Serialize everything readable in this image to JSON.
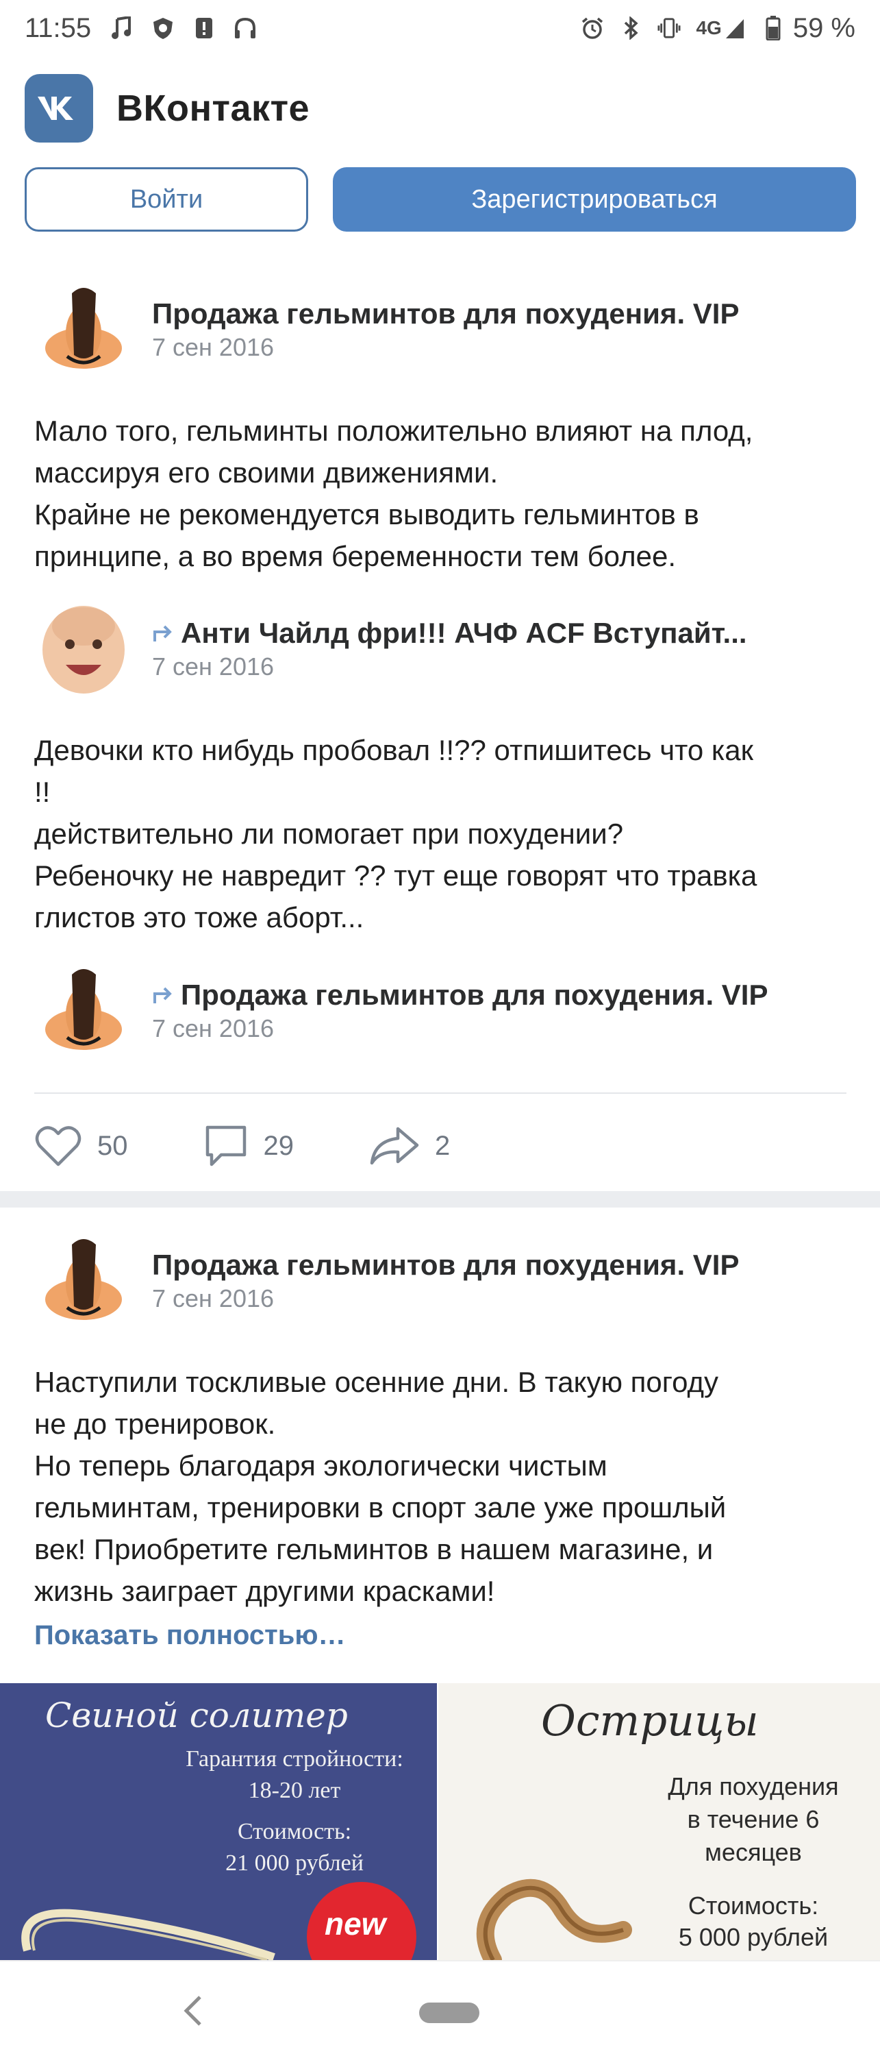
{
  "status_bar": {
    "time": "11:55",
    "network": "4G",
    "battery_percent": "59 %",
    "icons_left": [
      "music-note-icon",
      "shield-app-icon",
      "alert-icon",
      "headphones-icon"
    ],
    "icons_right": [
      "alarm-icon",
      "bluetooth-icon",
      "vibrate-icon",
      "signal-icon",
      "battery-icon"
    ]
  },
  "header": {
    "title": "ВКонтакте",
    "logo_text": "VK"
  },
  "auth": {
    "login_label": "Войти",
    "register_label": "Зарегистрироваться"
  },
  "posts": [
    {
      "author": "Продажа гельминтов для похудения. VIP",
      "date": "7 сен 2016",
      "text": "Мало того, гельминты положительно влияют на плод,\nмассируя его своими движениями.\nКрайне не рекомендуется выводить гельминтов в\nпринципе, а во время беременности тем более.",
      "reposts_chain": [
        {
          "author": "Анти Чайлд фри!!! АЧФ ACF Вступайт...",
          "date": "7 сен 2016",
          "text": "Девочки кто нибудь пробовал !!?? отпишитесь что как\n!!\nдействительно ли помогает при похудении?\nРебеночку не навредит ?? тут еще говорят что травка\nглистов это тоже аборт..."
        },
        {
          "author": "Продажа гельминтов для похудения. VIP",
          "date": "7 сен 2016"
        }
      ],
      "likes": "50",
      "comments": "29",
      "shares": "2"
    },
    {
      "author": "Продажа гельминтов для похудения. VIP",
      "date": "7 сен 2016",
      "text": "Наступили тоскливые осенние дни. В такую погоду\nне до тренировок.\nНо теперь благодаря экологически чистым\nгельминтам, тренировки в спорт зале уже прошлый\nвек! Приобретите гельминтов в нашем магазине, и\nжизнь заиграет другими красками!",
      "show_more": "Показать полностью…",
      "images": [
        {
          "title": "Свиной солитер",
          "line1": "Гарантия стройности:",
          "line2": "18-20 лет",
          "line3": "Стоимость:",
          "line4": "21 000 рублей",
          "badge": "new"
        },
        {
          "title": "Острицы",
          "line1": "Для похудения",
          "line2": "в течение 6",
          "line3": "месяцев",
          "line4": "Стоимость:",
          "line5": "5 000 рублей"
        }
      ]
    }
  ],
  "colors": {
    "vk_blue": "#4a76a8",
    "register_bg": "#4f84c4",
    "link": "#4a76a8",
    "muted": "#8a8f96"
  }
}
